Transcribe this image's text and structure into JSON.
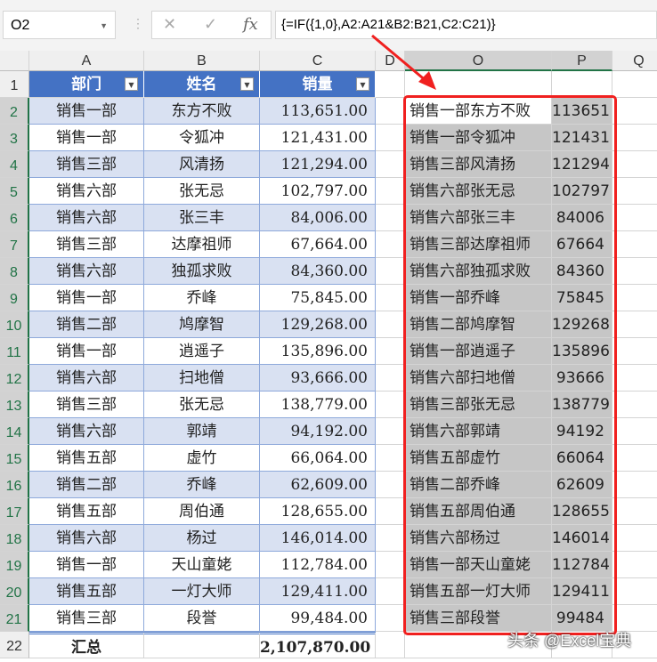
{
  "name_box": "O2",
  "formula": "{=IF({1,0},A2:A21&B2:B21,C2:C21)}",
  "formula_icons": [
    "cancel-icon",
    "enter-icon",
    "fx-icon"
  ],
  "columns": [
    "A",
    "B",
    "C",
    "D",
    "O",
    "P",
    "Q"
  ],
  "headers": [
    "部门",
    "姓名",
    "销量"
  ],
  "rows": [
    [
      "销售一部",
      "东方不败",
      "113,651.00",
      "销售一部东方不败",
      "113651"
    ],
    [
      "销售一部",
      "令狐冲",
      "121,431.00",
      "销售一部令狐冲",
      "121431"
    ],
    [
      "销售三部",
      "风清扬",
      "121,294.00",
      "销售三部风清扬",
      "121294"
    ],
    [
      "销售六部",
      "张无忌",
      "102,797.00",
      "销售六部张无忌",
      "102797"
    ],
    [
      "销售六部",
      "张三丰",
      "84,006.00",
      "销售六部张三丰",
      "84006"
    ],
    [
      "销售三部",
      "达摩祖师",
      "67,664.00",
      "销售三部达摩祖师",
      "67664"
    ],
    [
      "销售六部",
      "独孤求败",
      "84,360.00",
      "销售六部独孤求败",
      "84360"
    ],
    [
      "销售一部",
      "乔峰",
      "75,845.00",
      "销售一部乔峰",
      "75845"
    ],
    [
      "销售二部",
      "鸠摩智",
      "129,268.00",
      "销售二部鸠摩智",
      "129268"
    ],
    [
      "销售一部",
      "逍遥子",
      "135,896.00",
      "销售一部逍遥子",
      "135896"
    ],
    [
      "销售六部",
      "扫地僧",
      "93,666.00",
      "销售六部扫地僧",
      "93666"
    ],
    [
      "销售三部",
      "张无忌",
      "138,779.00",
      "销售三部张无忌",
      "138779"
    ],
    [
      "销售六部",
      "郭靖",
      "94,192.00",
      "销售六部郭靖",
      "94192"
    ],
    [
      "销售五部",
      "虚竹",
      "66,064.00",
      "销售五部虚竹",
      "66064"
    ],
    [
      "销售二部",
      "乔峰",
      "62,609.00",
      "销售二部乔峰",
      "62609"
    ],
    [
      "销售五部",
      "周伯通",
      "128,655.00",
      "销售五部周伯通",
      "128655"
    ],
    [
      "销售六部",
      "杨过",
      "146,014.00",
      "销售六部杨过",
      "146014"
    ],
    [
      "销售一部",
      "天山童姥",
      "112,784.00",
      "销售一部天山童姥",
      "112784"
    ],
    [
      "销售五部",
      "一灯大师",
      "129,411.00",
      "销售五部一灯大师",
      "129411"
    ],
    [
      "销售三部",
      "段誉",
      "99,484.00",
      "销售三部段誉",
      "99484"
    ]
  ],
  "total_label": "汇总",
  "total_value": "2,107,870.00",
  "watermark": "头条 @Excel宝典",
  "colors": {
    "header": "#4472c4",
    "band": "#d9e1f2",
    "highlight": "#f0201f"
  }
}
